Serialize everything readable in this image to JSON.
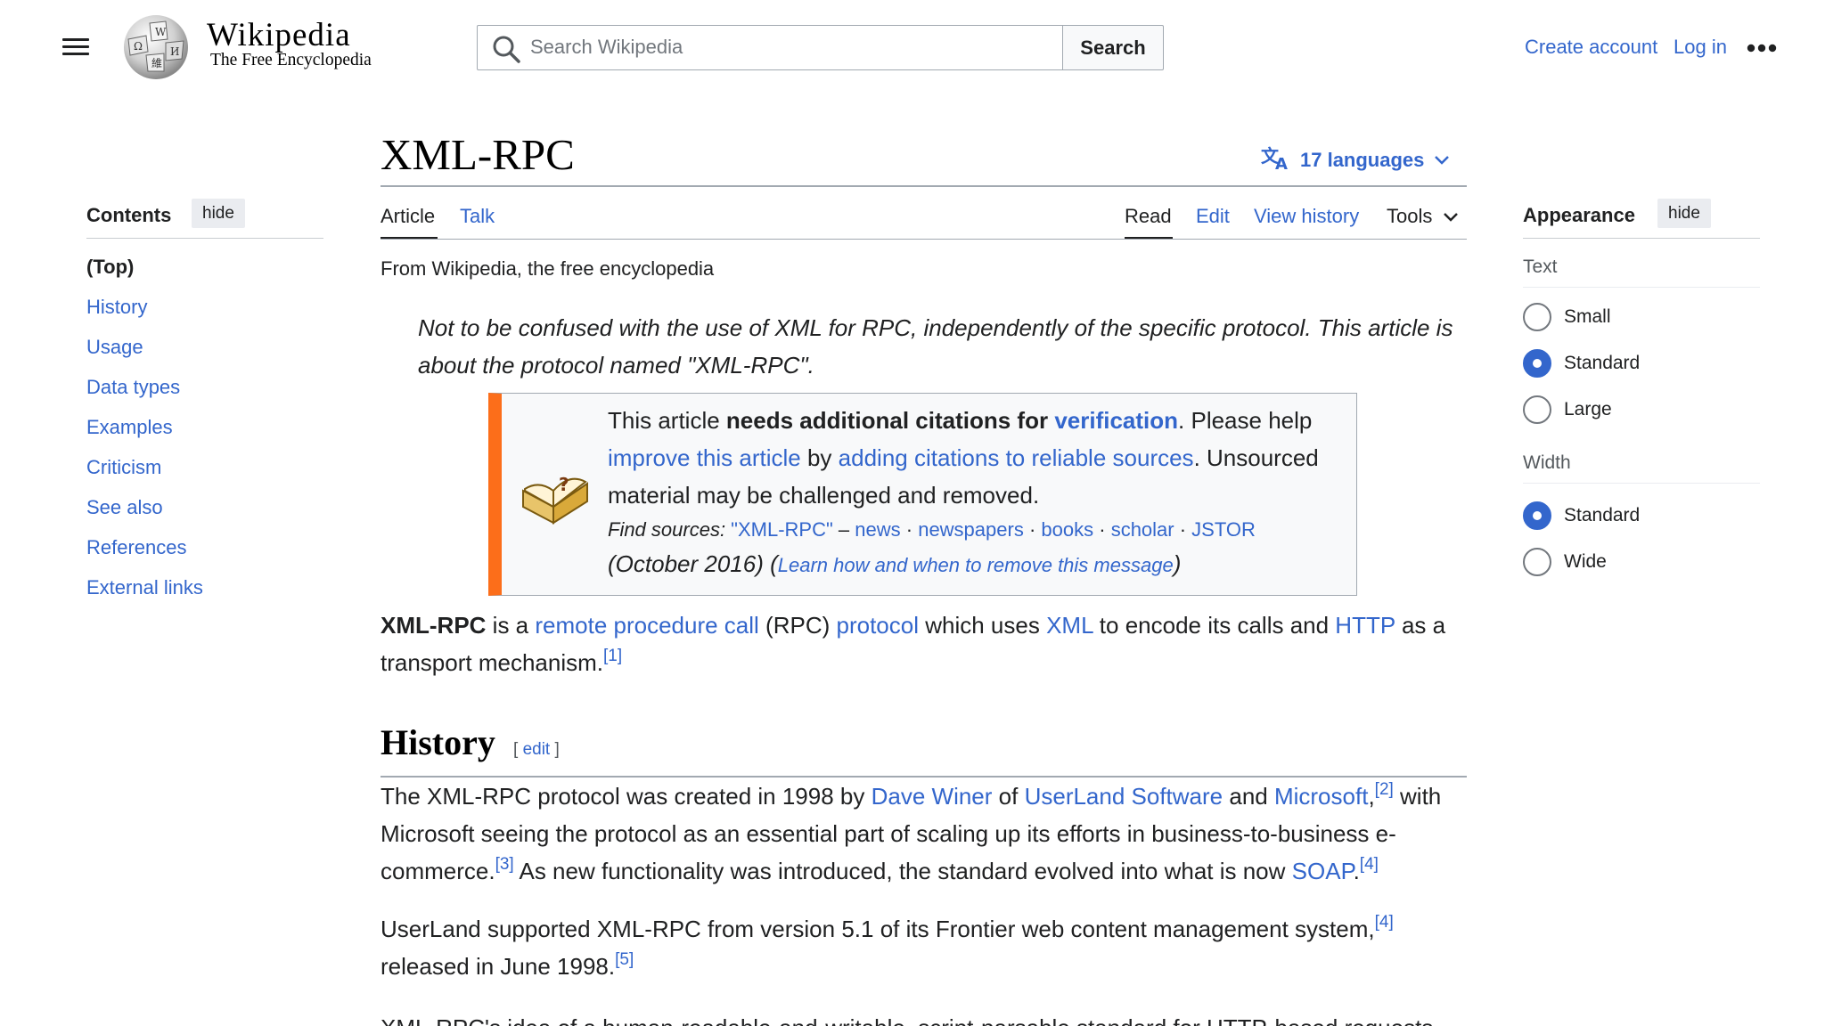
{
  "header": {
    "wordmark": "Wikipedia",
    "tagline": "The Free Encyclopedia",
    "search_placeholder": "Search Wikipedia",
    "search_button": "Search",
    "create_account": "Create account",
    "log_in": "Log in"
  },
  "title": "XML-RPC",
  "languages": "17 languages",
  "tabs": {
    "article": "Article",
    "talk": "Talk",
    "read": "Read",
    "edit": "Edit",
    "history": "View history",
    "tools": "Tools"
  },
  "toc": {
    "title": "Contents",
    "hide": "hide",
    "items": [
      "(Top)",
      "History",
      "Usage",
      "Data types",
      "Examples",
      "Criticism",
      "See also",
      "References",
      "External links"
    ]
  },
  "appearance": {
    "title": "Appearance",
    "hide": "hide",
    "text_heading": "Text",
    "text_options": [
      "Small",
      "Standard",
      "Large"
    ],
    "text_selected": "Standard",
    "width_heading": "Width",
    "width_options": [
      "Standard",
      "Wide"
    ],
    "width_selected": "Standard"
  },
  "from_wiki": "From Wikipedia, the free encyclopedia",
  "hatnote": "Not to be confused with the use of XML for RPC, independently of the specific protocol. This article is about the protocol named \"XML-RPC\".",
  "ambox": {
    "t1": "This article ",
    "t2": "needs additional citations for ",
    "t3": "verification",
    "t4": ". Please help ",
    "t5": "improve this article",
    "t6": " by ",
    "t7": "adding citations to reliable sources",
    "t8": ". Unsourced material may be challenged and removed.",
    "find_label": "Find sources: ",
    "find_query": "\"XML-RPC\"",
    "dash": " – ",
    "src_news": "news",
    "src_newspapers": "newspapers",
    "src_books": "books",
    "src_scholar": "scholar",
    "src_jstor": "JSTOR",
    "sep": " · ",
    "date": "(October 2016)",
    "learn_open": " (",
    "learn": "Learn how and when to remove this message",
    "learn_close": ")"
  },
  "lead": {
    "b": "XML-RPC",
    "t1": " is a ",
    "l1": "remote procedure call",
    "t2": " (RPC) ",
    "l2": "protocol",
    "t3": " which uses ",
    "l3": "XML",
    "t4": " to encode its calls and ",
    "l4": "HTTP",
    "t5": " as a transport mechanism.",
    "ref1": "[1]"
  },
  "history": {
    "heading": "History",
    "edit_open": "[ ",
    "edit": "edit",
    "edit_close": " ]",
    "p1_t1": "The XML-RPC protocol was created in 1998 by ",
    "p1_l1": "Dave Winer",
    "p1_t2": " of ",
    "p1_l2": "UserLand Software",
    "p1_t3": " and ",
    "p1_l3": "Microsoft",
    "p1_t4": ",",
    "p1_r2": "[2]",
    "p1_t5": " with Microsoft seeing the protocol as an essential part of scaling up its efforts in business-to-business e-commerce.",
    "p1_r3": "[3]",
    "p1_t6": " As new functionality was introduced, the standard evolved into what is now ",
    "p1_l4": "SOAP",
    "p1_t7": ".",
    "p1_r4": "[4]",
    "p2_t1": "UserLand supported XML-RPC from version 5.1 of its Frontier web content management system,",
    "p2_r4": "[4]",
    "p2_t2": " released in June 1998.",
    "p2_r5": "[5]",
    "p3_t1": "XML-RPC's idea of a human-readable-and-writable, script-parsable standard for HTTP-based requests"
  }
}
